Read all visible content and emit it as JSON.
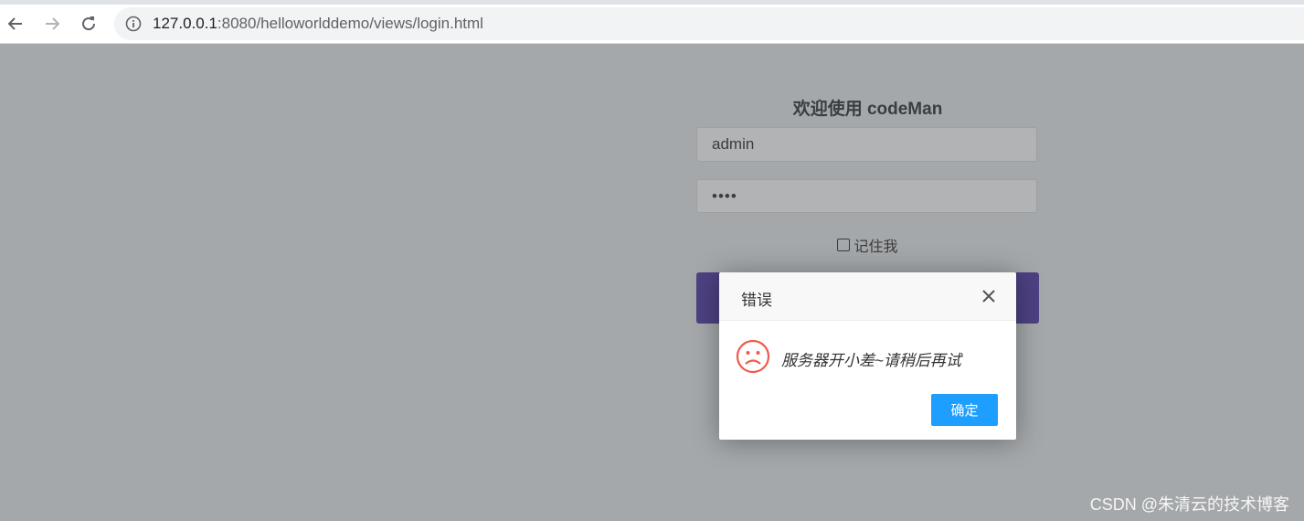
{
  "browser": {
    "url_host": "127.0.0.1",
    "url_rest": ":8080/helloworlddemo/views/login.html",
    "back_icon": "back-arrow-icon",
    "forward_icon": "forward-arrow-icon",
    "reload_icon": "reload-icon",
    "info_icon": "info-icon"
  },
  "login": {
    "title": "欢迎使用 codeMan",
    "username_value": "admin",
    "password_value": "••••",
    "remember_label": "记住我",
    "button_color": "#4e4182"
  },
  "dialog": {
    "title": "错误",
    "message": "服务器开小差~请稍后再试",
    "ok_label": "确定",
    "icon": "sad-face-icon",
    "ok_color": "#1e9fff"
  },
  "watermark": "CSDN @朱清云的技术博客"
}
